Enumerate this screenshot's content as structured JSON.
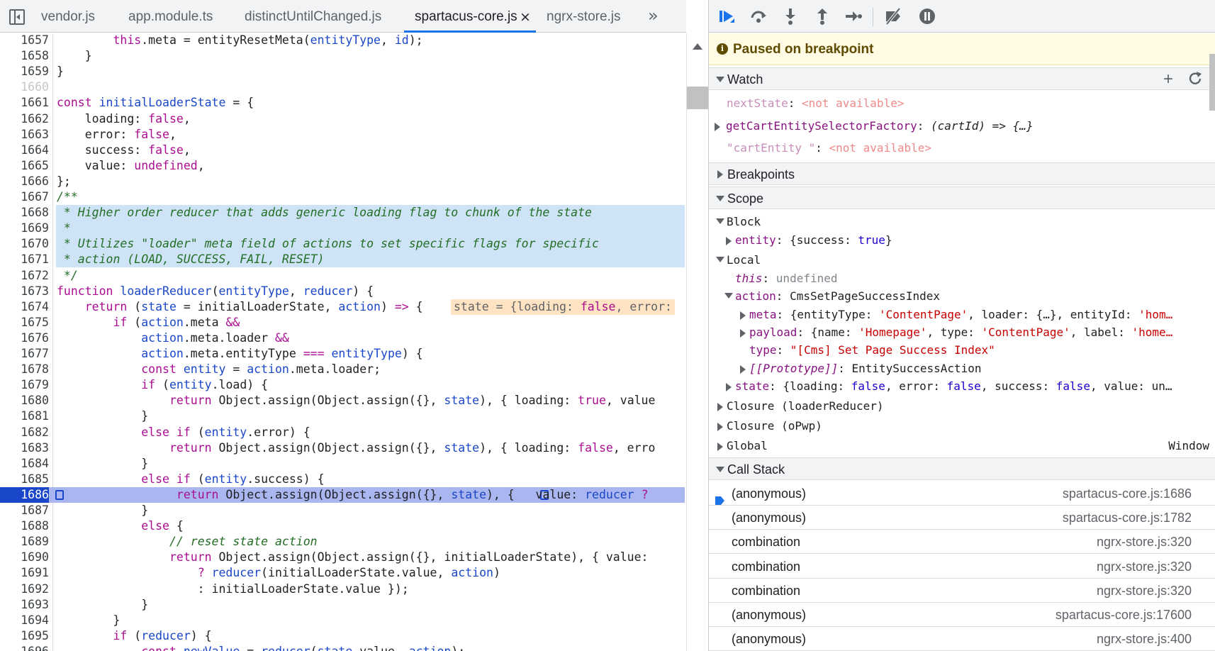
{
  "tabs": [
    {
      "label": "vendor.js"
    },
    {
      "label": "app.module.ts"
    },
    {
      "label": "distinctUntilChanged.js"
    },
    {
      "label": "spartacus-core.js",
      "active": true
    },
    {
      "label": "ngrx-store.js"
    }
  ],
  "tab_close": "×",
  "overflow_glyph": "»",
  "code": {
    "current_line": 1686,
    "lines": [
      {
        "n": "1657",
        "html": "        <span class=\"k\">this</span>.meta = entityResetMeta(<span class=\"def\">entityType</span>, <span class=\"def\">id</span>);"
      },
      {
        "n": "1658",
        "html": "    }"
      },
      {
        "n": "1659",
        "html": "}"
      },
      {
        "n": "1660",
        "html": "",
        "dim": true
      },
      {
        "n": "1661",
        "html": "<span class=\"k\">const</span> <span class=\"def\">initialLoaderState</span> = {"
      },
      {
        "n": "1662",
        "html": "    loading: <span class=\"k\">false</span>,"
      },
      {
        "n": "1663",
        "html": "    error: <span class=\"k\">false</span>,"
      },
      {
        "n": "1664",
        "html": "    success: <span class=\"k\">false</span>,"
      },
      {
        "n": "1665",
        "html": "    value: <span class=\"k\">undefined</span>,"
      },
      {
        "n": "1666",
        "html": "};"
      },
      {
        "n": "1667",
        "html": "<span class=\"c\">/**</span>"
      },
      {
        "n": "1668",
        "html": "<span class=\"c\"> * Higher order reducer that adds generic loading flag to chunk of the state</span>",
        "hl": true
      },
      {
        "n": "1669",
        "html": "<span class=\"c\"> *</span>",
        "hl": true
      },
      {
        "n": "1670",
        "html": "<span class=\"c\"> * Utilizes \"loader\" meta field of actions to set specific flags for specific</span>",
        "hl": true
      },
      {
        "n": "1671",
        "html": "<span class=\"c\"> * action (LOAD, SUCCESS, FAIL, RESET)</span>",
        "hl": true
      },
      {
        "n": "1672",
        "html": "<span class=\"c\"> */</span>"
      },
      {
        "n": "1673",
        "html": "<span class=\"k\">function</span> <span class=\"def\">loaderReducer</span>(<span class=\"def\">entityType</span>, <span class=\"def\">reducer</span>) {"
      },
      {
        "n": "1674",
        "html": "    <span class=\"k\">return</span> (<span class=\"def\">state</span> = initialLoaderState, <span class=\"def\">action</span>) <span class=\"k\">=&gt;</span> {",
        "inline": "state = {loading: <span class=\"k\">false</span>, error:"
      },
      {
        "n": "1675",
        "html": "        <span class=\"k\">if</span> (<span class=\"def\">action</span>.meta <span class=\"k\">&amp;&amp;</span>"
      },
      {
        "n": "1676",
        "html": "            <span class=\"def\">action</span>.meta.loader <span class=\"k\">&amp;&amp;</span>"
      },
      {
        "n": "1677",
        "html": "            <span class=\"def\">action</span>.meta.entityType <span class=\"k\">===</span> <span class=\"def\">entityType</span>) {"
      },
      {
        "n": "1678",
        "html": "            <span class=\"k\">const</span> <span class=\"def\">entity</span> = <span class=\"def\">action</span>.meta.loader;"
      },
      {
        "n": "1679",
        "html": "            <span class=\"k\">if</span> (<span class=\"def\">entity</span>.load) {"
      },
      {
        "n": "1680",
        "html": "                <span class=\"k\">return</span> Object.assign(Object.assign({}, <span class=\"def\">state</span>), { loading: <span class=\"k\">true</span>, value"
      },
      {
        "n": "1681",
        "html": "            }"
      },
      {
        "n": "1682",
        "html": "            <span class=\"k\">else if</span> (<span class=\"def\">entity</span>.error) {"
      },
      {
        "n": "1683",
        "html": "                <span class=\"k\">return</span> Object.assign(Object.assign({}, <span class=\"def\">state</span>), { loading: <span class=\"k\">false</span>, erro"
      },
      {
        "n": "1684",
        "html": "            }"
      },
      {
        "n": "1685",
        "html": "            <span class=\"k\">else if</span> (<span class=\"def\">entity</span>.success) {"
      },
      {
        "n": "1686",
        "html": "                 <span class=\"k\">return</span> Object.assign(Object.assign({}, <span class=\"def\">state</span>), {   value: <span class=\"def\">reducer</span> <span class=\"k\">?</span>",
        "exec": true
      },
      {
        "n": "1687",
        "html": "            }"
      },
      {
        "n": "1688",
        "html": "            <span class=\"k\">else</span> {"
      },
      {
        "n": "1689",
        "html": "                <span class=\"c\">// reset state action</span>"
      },
      {
        "n": "1690",
        "html": "                <span class=\"k\">return</span> Object.assign(Object.assign({}, initialLoaderState), { value:"
      },
      {
        "n": "1691",
        "html": "                    <span class=\"k\">?</span> <span class=\"def\">reducer</span>(initialLoaderState.value, <span class=\"def\">action</span>)"
      },
      {
        "n": "1692",
        "html": "                    : initialLoaderState.value });"
      },
      {
        "n": "1693",
        "html": "            }"
      },
      {
        "n": "1694",
        "html": "        }"
      },
      {
        "n": "1695",
        "html": "        <span class=\"k\">if</span> (<span class=\"def\">reducer</span>) {"
      },
      {
        "n": "1696",
        "html": "            <span class=\"k\">const</span> <span class=\"def\">newValue</span> = <span class=\"def\">reducer</span>(<span class=\"def\">state</span>.value, <span class=\"def\">action</span>);"
      }
    ]
  },
  "paused": {
    "text": "Paused on breakpoint"
  },
  "watch": {
    "title": "Watch",
    "items": [
      {
        "name": "nextState",
        "value": "<not available>"
      },
      {
        "name": "getCartEntitySelectorFactory",
        "value": "(cartId) => {…}"
      },
      {
        "name": "\"cartEntity \"",
        "value": "<not available>"
      }
    ]
  },
  "breakpoints": {
    "title": "Breakpoints"
  },
  "scope": {
    "title": "Scope",
    "block_label": "Block",
    "block_entity_name": "entity",
    "block_entity_value_pre": "{success: ",
    "block_entity_value_bool": "true",
    "block_entity_value_post": "}",
    "local_label": "Local",
    "this_name": "this",
    "this_value": "undefined",
    "action_name": "action",
    "action_value": "CmsSetPageSuccessIndex",
    "meta_name": "meta",
    "meta_value_a": "{entityType: ",
    "meta_value_b": "'ContentPage'",
    "meta_value_c": ", loader: {…}, entityId: ",
    "meta_value_d": "'hom…",
    "payload_name": "payload",
    "payload_value_a": "{name: ",
    "payload_value_b": "'Homepage'",
    "payload_value_c": ", type: ",
    "payload_value_d": "'ContentPage'",
    "payload_value_e": ", label: ",
    "payload_value_f": "'home…",
    "type_name": "type",
    "type_value": "\"[Cms] Set Page Success Index\"",
    "proto_name": "[[Prototype]]",
    "proto_value": "EntitySuccessAction",
    "state_name": "state",
    "state_value_a": "{loading: ",
    "state_value_b": "false",
    "state_value_c": ", error: ",
    "state_value_d": "false",
    "state_value_e": ", success: ",
    "state_value_f": "false",
    "state_value_g": ", value: un…",
    "closure1": "Closure (loaderReducer)",
    "closure2": "Closure (oPwp)",
    "global": "Global",
    "global_value": "Window"
  },
  "callstack": {
    "title": "Call Stack",
    "frames": [
      {
        "fn": "(anonymous)",
        "loc": "spartacus-core.js:1686",
        "current": true
      },
      {
        "fn": "(anonymous)",
        "loc": "spartacus-core.js:1782"
      },
      {
        "fn": "combination",
        "loc": "ngrx-store.js:320"
      },
      {
        "fn": "combination",
        "loc": "ngrx-store.js:320"
      },
      {
        "fn": "combination",
        "loc": "ngrx-store.js:320"
      },
      {
        "fn": "(anonymous)",
        "loc": "spartacus-core.js:17600"
      },
      {
        "fn": "(anonymous)",
        "loc": "ngrx-store.js:400"
      }
    ]
  },
  "colors": {
    "accent": "#1a73e8",
    "exec_line": "#aab6ef",
    "paused_bg": "#fffbe5"
  }
}
